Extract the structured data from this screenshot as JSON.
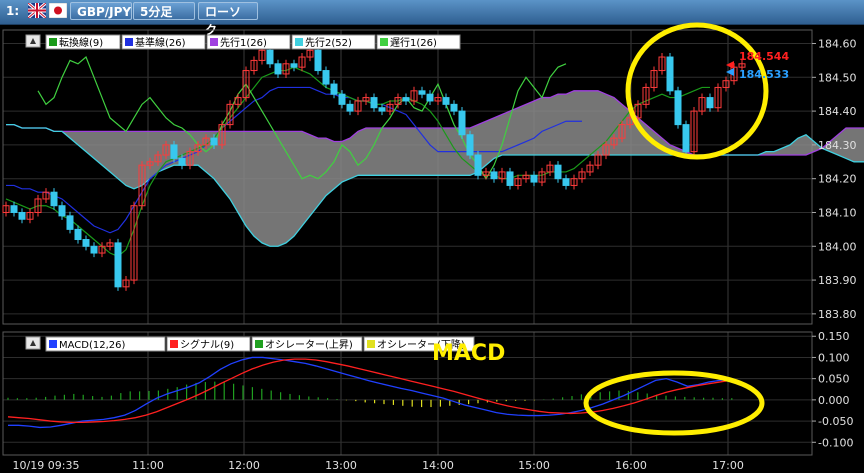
{
  "toolbar": {
    "window_index": "1:",
    "symbol": "GBP/JPY",
    "timeframe": "5分足",
    "chart_style": "ローソク"
  },
  "colors": {
    "background": "#000000",
    "bullish": "#ff3b3b",
    "bearish": "#38c8ee",
    "tenkan": "#1a9a1a",
    "kijun": "#2030e0",
    "senkou1": "#a040e0",
    "senkou2": "#40d0e0",
    "chikou": "#40d040",
    "kumo": "#8a8a8a",
    "macd": "#2040ff",
    "signal": "#ff2020",
    "osc_up": "#20a020",
    "osc_down": "#e0e020",
    "highlight": "#ffee00"
  },
  "annotation": "MACD",
  "chart_data": [
    {
      "type": "line",
      "subtype": "candlestick with ichimoku",
      "legend": [
        {
          "label": "転換線(9)",
          "color": "#1a9a1a"
        },
        {
          "label": "基準線(26)",
          "color": "#2030e0"
        },
        {
          "label": "先行1(26)",
          "color": "#a040e0"
        },
        {
          "label": "先行2(52)",
          "color": "#40d0e0"
        },
        {
          "label": "遅行1(26)",
          "color": "#40d040"
        }
      ],
      "legend_placement": "top-left",
      "y_ticks": [
        "184.60",
        "184.50",
        "184.40",
        "184.30",
        "184.20",
        "184.10",
        "184.00",
        "183.90",
        "183.80"
      ],
      "ylim": [
        183.77,
        184.64
      ],
      "last_price": "184.544",
      "last_price2": "184.533",
      "close": [
        184.12,
        184.1,
        184.08,
        184.1,
        184.14,
        184.16,
        184.12,
        184.09,
        184.05,
        184.02,
        184.0,
        183.98,
        184.0,
        184.01,
        183.88,
        183.9,
        184.12,
        184.24,
        184.25,
        184.27,
        184.3,
        184.26,
        184.24,
        184.28,
        184.3,
        184.32,
        184.3,
        184.36,
        184.42,
        184.44,
        184.52,
        184.55,
        184.58,
        184.54,
        184.51,
        184.54,
        184.53,
        184.56,
        184.58,
        184.52,
        184.48,
        184.45,
        184.42,
        184.4,
        184.43,
        184.44,
        184.41,
        184.4,
        184.42,
        184.44,
        184.43,
        184.46,
        184.45,
        184.43,
        184.44,
        184.42,
        184.4,
        184.33,
        184.27,
        184.21,
        184.22,
        184.2,
        184.22,
        184.18,
        184.2,
        184.21,
        184.19,
        184.22,
        184.24,
        184.2,
        184.18,
        184.2,
        184.22,
        184.24,
        184.27,
        184.3,
        184.32,
        184.36,
        184.38,
        184.42,
        184.47,
        184.52,
        184.56,
        184.46,
        184.36,
        184.28,
        184.4,
        184.44,
        184.41,
        184.47,
        184.49,
        184.53,
        184.54
      ],
      "tenkan": [
        184.14,
        184.13,
        184.12,
        184.11,
        184.12,
        184.12,
        184.11,
        184.09,
        184.08,
        184.06,
        184.04,
        184.02,
        184.0,
        183.98,
        183.97,
        183.99,
        184.05,
        184.12,
        184.18,
        184.22,
        184.25,
        184.26,
        184.27,
        184.28,
        184.29,
        184.3,
        184.32,
        184.35,
        184.38,
        184.41,
        184.44,
        184.47,
        184.5,
        184.51,
        184.52,
        184.52,
        184.53,
        184.52,
        184.51,
        184.49,
        184.47,
        184.46,
        184.45,
        184.44,
        184.43,
        184.43,
        184.42,
        184.42,
        184.43,
        184.43,
        184.44,
        184.43,
        184.42,
        184.4,
        184.37,
        184.33,
        184.29,
        184.26,
        184.24,
        184.22,
        184.21,
        184.21,
        184.2,
        184.2,
        184.21,
        184.21,
        184.21,
        184.21,
        184.22,
        184.22,
        184.22,
        184.23,
        184.25,
        184.27,
        184.29,
        184.31,
        184.34,
        184.37,
        184.4,
        184.42,
        184.43,
        184.44,
        184.45,
        184.44,
        184.44,
        184.45,
        184.46,
        184.47,
        184.47
      ],
      "kijun": [
        184.18,
        184.18,
        184.17,
        184.17,
        184.16,
        184.16,
        184.15,
        184.14,
        184.12,
        184.1,
        184.08,
        184.06,
        184.05,
        184.04,
        184.05,
        184.08,
        184.12,
        184.16,
        184.2,
        184.22,
        184.24,
        184.25,
        184.26,
        184.27,
        184.28,
        184.3,
        184.32,
        184.35,
        184.37,
        184.39,
        184.41,
        184.43,
        184.44,
        184.46,
        184.47,
        184.47,
        184.47,
        184.47,
        184.47,
        184.46,
        184.45,
        184.45,
        184.44,
        184.44,
        184.43,
        184.43,
        184.42,
        184.42,
        184.41,
        184.4,
        184.39,
        184.36,
        184.33,
        184.3,
        184.28,
        184.28,
        184.28,
        184.28,
        184.28,
        184.28,
        184.28,
        184.28,
        184.28,
        184.29,
        184.3,
        184.31,
        184.32,
        184.34,
        184.35,
        184.36,
        184.37,
        184.37,
        184.37
      ],
      "kumo_top": [
        184.36,
        184.36,
        184.35,
        184.35,
        184.35,
        184.35,
        184.34,
        184.34,
        184.34,
        184.34,
        184.34,
        184.34,
        184.34,
        184.34,
        184.34,
        184.34,
        184.34,
        184.34,
        184.34,
        184.34,
        184.34,
        184.34,
        184.34,
        184.34,
        184.34,
        184.34,
        184.34,
        184.34,
        184.34,
        184.34,
        184.34,
        184.34,
        184.34,
        184.34,
        184.34,
        184.34,
        184.34,
        184.34,
        184.33,
        184.32,
        184.32,
        184.31,
        184.31,
        184.32,
        184.34,
        184.35,
        184.35,
        184.35,
        184.35,
        184.35,
        184.35,
        184.35,
        184.35,
        184.35,
        184.35,
        184.35,
        184.35,
        184.35,
        184.35,
        184.36,
        184.37,
        184.38,
        184.39,
        184.4,
        184.41,
        184.42,
        184.43,
        184.44,
        184.44,
        184.45,
        184.45,
        184.46,
        184.46,
        184.46,
        184.46,
        184.45,
        184.44,
        184.42,
        184.4,
        184.38,
        184.36,
        184.34,
        184.32,
        184.3,
        184.29,
        184.28,
        184.27,
        184.27,
        184.27,
        184.27,
        184.27,
        184.27,
        184.27,
        184.27,
        184.27,
        184.27,
        184.27,
        184.27,
        184.27,
        184.27,
        184.27,
        184.28,
        184.29,
        184.31,
        184.33,
        184.35,
        184.35,
        184.35,
        184.35,
        184.35,
        184.35,
        184.35,
        184.35,
        184.35
      ],
      "kumo_bottom": [
        184.36,
        184.36,
        184.35,
        184.35,
        184.35,
        184.35,
        184.34,
        184.34,
        184.32,
        184.3,
        184.28,
        184.26,
        184.24,
        184.22,
        184.2,
        184.18,
        184.17,
        184.18,
        184.2,
        184.22,
        184.23,
        184.24,
        184.24,
        184.24,
        184.24,
        184.22,
        184.2,
        184.17,
        184.14,
        184.1,
        184.06,
        184.03,
        184.01,
        184.0,
        184.0,
        184.01,
        184.03,
        184.06,
        184.09,
        184.12,
        184.15,
        184.17,
        184.19,
        184.2,
        184.21,
        184.21,
        184.21,
        184.21,
        184.21,
        184.21,
        184.21,
        184.21,
        184.21,
        184.21,
        184.21,
        184.21,
        184.21,
        184.21,
        184.21,
        184.22,
        184.24,
        184.26,
        184.27,
        184.27,
        184.27,
        184.27,
        184.27,
        184.27,
        184.27,
        184.27,
        184.27,
        184.27,
        184.27,
        184.27,
        184.27,
        184.27,
        184.27,
        184.27,
        184.27,
        184.27,
        184.27,
        184.27,
        184.27,
        184.27,
        184.27,
        184.27,
        184.27,
        184.27,
        184.27,
        184.27,
        184.27,
        184.27,
        184.27,
        184.27,
        184.27,
        184.28,
        184.28,
        184.29,
        184.3,
        184.32,
        184.33,
        184.31,
        184.29,
        184.28,
        184.27,
        184.26,
        184.25,
        184.25,
        184.25,
        184.25,
        184.25,
        184.25,
        184.25,
        184.25
      ],
      "chikou": [
        184.46,
        184.42,
        184.44,
        184.5,
        184.55,
        184.54,
        184.56,
        184.5,
        184.44,
        184.38,
        184.36,
        184.34,
        184.38,
        184.42,
        184.44,
        184.41,
        184.38,
        184.36,
        184.35,
        184.33,
        184.3,
        184.28,
        184.3,
        184.36,
        184.4,
        184.45,
        184.48,
        184.44,
        184.4,
        184.36,
        184.32,
        184.28,
        184.24,
        184.2,
        184.21,
        184.2,
        184.22,
        184.25,
        184.3,
        184.28,
        184.24,
        184.26,
        184.3,
        184.35,
        184.38,
        184.42,
        184.44,
        184.41,
        184.4,
        184.44,
        184.48,
        184.42,
        184.36,
        184.32,
        184.27,
        184.24,
        184.2,
        184.24,
        184.3,
        184.38,
        184.46,
        184.5,
        184.47,
        184.44,
        184.5,
        184.53,
        184.54
      ]
    },
    {
      "type": "line",
      "subtype": "macd",
      "legend": [
        {
          "label": "MACD(12,26)",
          "color": "#2040ff"
        },
        {
          "label": "シグナル(9)",
          "color": "#ff2020"
        },
        {
          "label": "オシレーター(上昇)",
          "color": "#20a020"
        },
        {
          "label": "オシレーター(下降)",
          "color": "#e0e020"
        }
      ],
      "legend_placement": "top-left",
      "y_ticks": [
        "0.150",
        "0.100",
        "0.050",
        "0.000",
        "-0.050",
        "-0.100"
      ],
      "ylim": [
        -0.13,
        0.16
      ],
      "macd": [
        -0.06,
        -0.06,
        -0.062,
        -0.065,
        -0.064,
        -0.06,
        -0.055,
        -0.05,
        -0.048,
        -0.046,
        -0.042,
        -0.036,
        -0.025,
        -0.01,
        0.004,
        0.014,
        0.022,
        0.03,
        0.04,
        0.055,
        0.072,
        0.085,
        0.094,
        0.1,
        0.1,
        0.097,
        0.094,
        0.09,
        0.086,
        0.08,
        0.073,
        0.066,
        0.059,
        0.052,
        0.045,
        0.039,
        0.033,
        0.027,
        0.022,
        0.016,
        0.01,
        0.004,
        -0.004,
        -0.012,
        -0.018,
        -0.024,
        -0.03,
        -0.034,
        -0.036,
        -0.037,
        -0.037,
        -0.036,
        -0.034,
        -0.03,
        -0.025,
        -0.018,
        -0.01,
        0.0,
        0.01,
        0.022,
        0.034,
        0.046,
        0.05,
        0.042,
        0.032,
        0.036,
        0.042,
        0.046,
        0.048
      ],
      "signal": [
        -0.04,
        -0.042,
        -0.044,
        -0.047,
        -0.05,
        -0.052,
        -0.053,
        -0.053,
        -0.052,
        -0.051,
        -0.049,
        -0.046,
        -0.042,
        -0.036,
        -0.028,
        -0.018,
        -0.008,
        0.002,
        0.013,
        0.025,
        0.038,
        0.05,
        0.062,
        0.073,
        0.082,
        0.089,
        0.094,
        0.096,
        0.096,
        0.094,
        0.09,
        0.085,
        0.08,
        0.074,
        0.068,
        0.062,
        0.056,
        0.05,
        0.044,
        0.038,
        0.032,
        0.026,
        0.02,
        0.013,
        0.006,
        -0.001,
        -0.008,
        -0.014,
        -0.019,
        -0.023,
        -0.027,
        -0.03,
        -0.031,
        -0.032,
        -0.031,
        -0.029,
        -0.025,
        -0.02,
        -0.014,
        -0.007,
        0.001,
        0.01,
        0.018,
        0.024,
        0.029,
        0.034,
        0.038,
        0.042,
        0.046
      ],
      "oscillator": [
        0.005,
        0.004,
        0.004,
        0.005,
        0.007,
        0.01,
        0.012,
        0.014,
        0.012,
        0.009,
        0.007,
        0.01,
        0.016,
        0.02,
        0.02,
        0.021,
        0.022,
        0.026,
        0.03,
        0.036,
        0.04,
        0.042,
        0.043,
        0.042,
        0.038,
        0.034,
        0.03,
        0.026,
        0.022,
        0.018,
        0.014,
        0.011,
        0.008,
        0.006,
        0.004,
        0.002,
        -0.001,
        -0.003,
        -0.006,
        -0.008,
        -0.01,
        -0.012,
        -0.014,
        -0.016,
        -0.017,
        -0.017,
        -0.016,
        -0.014,
        -0.012,
        -0.01,
        -0.008,
        -0.006,
        -0.004,
        -0.003,
        -0.002,
        -0.002,
        -0.001,
        0.001,
        0.003,
        0.006,
        0.009,
        0.013,
        0.016,
        0.018,
        0.02,
        0.022,
        0.021,
        0.018,
        0.015,
        0.012,
        0.01,
        0.008,
        0.007,
        0.006,
        0.005,
        0.005,
        0.004,
        0.004
      ]
    }
  ],
  "x_axis": {
    "labels": [
      "10/19 09:35",
      "11:00",
      "12:00",
      "13:00",
      "14:00",
      "15:00",
      "16:00",
      "17:00"
    ]
  }
}
